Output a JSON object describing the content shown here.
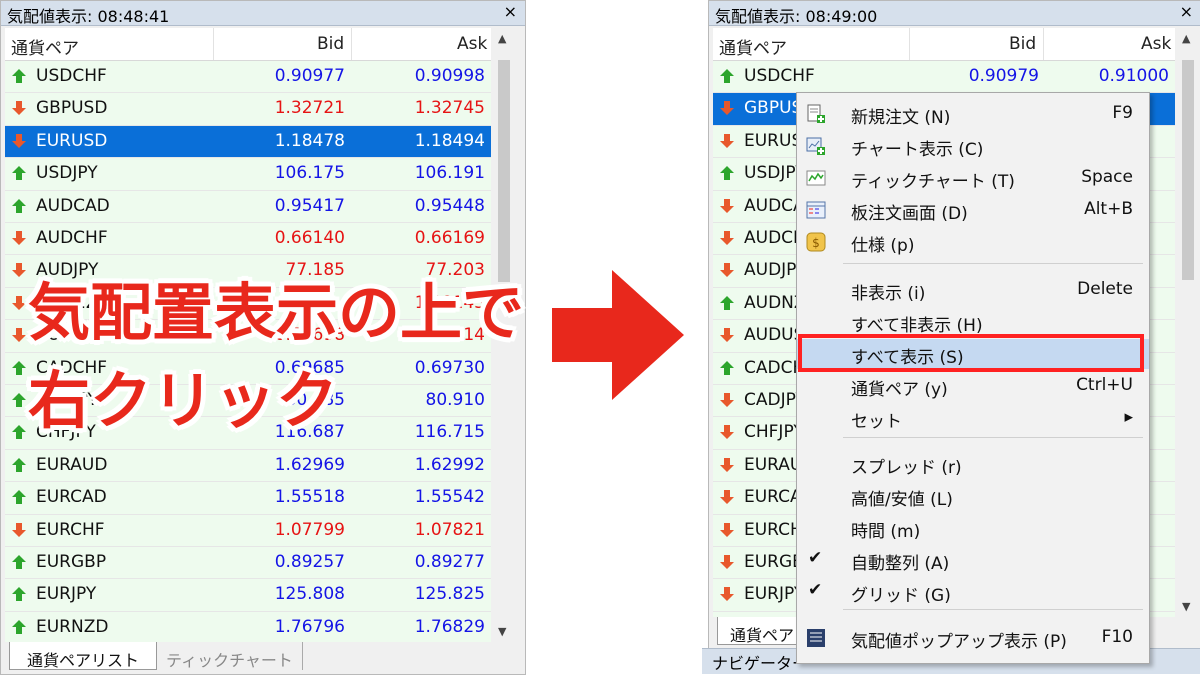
{
  "left_panel": {
    "title": "気配値表示: 08:48:41",
    "close": "×",
    "columns": {
      "symbol": "通貨ペア",
      "bid": "Bid",
      "ask": "Ask"
    },
    "rows": [
      {
        "symbol": "USDCHF",
        "bid": "0.90977",
        "ask": "0.90998",
        "dir": "up"
      },
      {
        "symbol": "GBPUSD",
        "bid": "1.32721",
        "ask": "1.32745",
        "dir": "down"
      },
      {
        "symbol": "EURUSD",
        "bid": "1.18478",
        "ask": "1.18494",
        "dir": "down",
        "selected": true
      },
      {
        "symbol": "USDJPY",
        "bid": "106.175",
        "ask": "106.191",
        "dir": "up"
      },
      {
        "symbol": "AUDCAD",
        "bid": "0.95417",
        "ask": "0.95448",
        "dir": "up"
      },
      {
        "symbol": "AUDCHF",
        "bid": "0.66140",
        "ask": "0.66169",
        "dir": "down"
      },
      {
        "symbol": "AUDJPY",
        "bid": "77.185",
        "ask": "77.203",
        "dir": "down"
      },
      {
        "symbol": "AUDNZD",
        "bid": "",
        "ask": "1.08143",
        "dir": "down"
      },
      {
        "symbol": "AUDUSD",
        "bid": "0.72698",
        "ask": "0.72714",
        "dir": "down"
      },
      {
        "symbol": "CADCHF",
        "bid": "0.69685",
        "ask": "0.69730",
        "dir": "up"
      },
      {
        "symbol": "CADJPY",
        "bid": "80.885",
        "ask": "80.910",
        "dir": "up"
      },
      {
        "symbol": "CHFJPY",
        "bid": "116.687",
        "ask": "116.715",
        "dir": "up"
      },
      {
        "symbol": "EURAUD",
        "bid": "1.62969",
        "ask": "1.62992",
        "dir": "up"
      },
      {
        "symbol": "EURCAD",
        "bid": "1.55518",
        "ask": "1.55542",
        "dir": "up"
      },
      {
        "symbol": "EURCHF",
        "bid": "1.07799",
        "ask": "1.07821",
        "dir": "down"
      },
      {
        "symbol": "EURGBP",
        "bid": "0.89257",
        "ask": "0.89277",
        "dir": "up"
      },
      {
        "symbol": "EURJPY",
        "bid": "125.808",
        "ask": "125.825",
        "dir": "up"
      },
      {
        "symbol": "EURNZD",
        "bid": "1.76796",
        "ask": "1.76829",
        "dir": "up"
      }
    ],
    "tabs": [
      "通貨ペアリスト",
      "ティックチャート"
    ]
  },
  "overlay_text": {
    "line1": "気配置表示の上で",
    "line2": "右クリック"
  },
  "right_panel": {
    "title": "気配値表示: 08:49:00",
    "close": "×",
    "columns": {
      "symbol": "通貨ペア",
      "bid": "Bid",
      "ask": "Ask"
    },
    "rows": [
      {
        "symbol": "USDCHF",
        "bid": "0.90979",
        "ask": "0.91000",
        "dir": "up"
      },
      {
        "symbol": "GBPUSD",
        "bid": "",
        "ask": "",
        "dir": "down",
        "selected": true
      },
      {
        "symbol": "EURUSD",
        "bid": "",
        "ask": "",
        "dir": "down"
      },
      {
        "symbol": "USDJPY",
        "bid": "",
        "ask": "",
        "dir": "up"
      },
      {
        "symbol": "AUDCAD",
        "bid": "",
        "ask": "",
        "dir": "down"
      },
      {
        "symbol": "AUDCHF",
        "bid": "",
        "ask": "",
        "dir": "down"
      },
      {
        "symbol": "AUDJPY",
        "bid": "",
        "ask": "",
        "dir": "down"
      },
      {
        "symbol": "AUDNZD",
        "bid": "",
        "ask": "",
        "dir": "up"
      },
      {
        "symbol": "AUDUSD",
        "bid": "",
        "ask": "",
        "dir": "down"
      },
      {
        "symbol": "CADCHF",
        "bid": "",
        "ask": "",
        "dir": "up"
      },
      {
        "symbol": "CADJPY",
        "bid": "",
        "ask": "",
        "dir": "down"
      },
      {
        "symbol": "CHFJPY",
        "bid": "",
        "ask": "",
        "dir": "down"
      },
      {
        "symbol": "EURAUD",
        "bid": "",
        "ask": "",
        "dir": "down"
      },
      {
        "symbol": "EURCAD",
        "bid": "",
        "ask": "",
        "dir": "down"
      },
      {
        "symbol": "EURCHF",
        "bid": "",
        "ask": "",
        "dir": "down"
      },
      {
        "symbol": "EURGBP",
        "bid": "",
        "ask": "",
        "dir": "down"
      },
      {
        "symbol": "EURJPY",
        "bid": "",
        "ask": "",
        "dir": "down"
      },
      {
        "symbol": "EURNZD",
        "bid": "",
        "ask": "",
        "dir": "down"
      }
    ],
    "tab": "通貨ペア",
    "navigator": "ナビゲーター"
  },
  "context_menu": [
    {
      "label": "新規注文 (N)",
      "shortcut": "F9",
      "icon": "new-order-icon"
    },
    {
      "label": "チャート表示 (C)",
      "shortcut": "",
      "icon": "chart-window-icon"
    },
    {
      "label": "ティックチャート (T)",
      "shortcut": "Space",
      "icon": "tick-chart-icon"
    },
    {
      "label": "板注文画面 (D)",
      "shortcut": "Alt+B",
      "icon": "depth-of-market-icon"
    },
    {
      "label": "仕様 (p)",
      "shortcut": "",
      "icon": "specification-icon"
    },
    {
      "label": "非表示 (i)",
      "shortcut": "Delete"
    },
    {
      "label": "すべて非表示 (H)",
      "shortcut": ""
    },
    {
      "label": "すべて表示 (S)",
      "shortcut": "",
      "highlighted": true
    },
    {
      "label": "通貨ペア (y)",
      "shortcut": "Ctrl+U"
    },
    {
      "label": "セット",
      "shortcut": "▸"
    },
    {
      "label": "スプレッド (r)",
      "shortcut": ""
    },
    {
      "label": "高値/安値 (L)",
      "shortcut": ""
    },
    {
      "label": "時間 (m)",
      "shortcut": ""
    },
    {
      "label": "自動整列 (A)",
      "shortcut": "",
      "checked": true
    },
    {
      "label": "グリッド (G)",
      "shortcut": "",
      "checked": true
    },
    {
      "label": "気配値ポップアップ表示 (P)",
      "shortcut": "F10",
      "icon": "popup-prices-icon"
    }
  ],
  "colors": {
    "up": "#1414e6",
    "down": "#e61414",
    "selected": "#0a6fd8",
    "arrow": "#e8281c",
    "highlight_box": "#ff2222"
  }
}
